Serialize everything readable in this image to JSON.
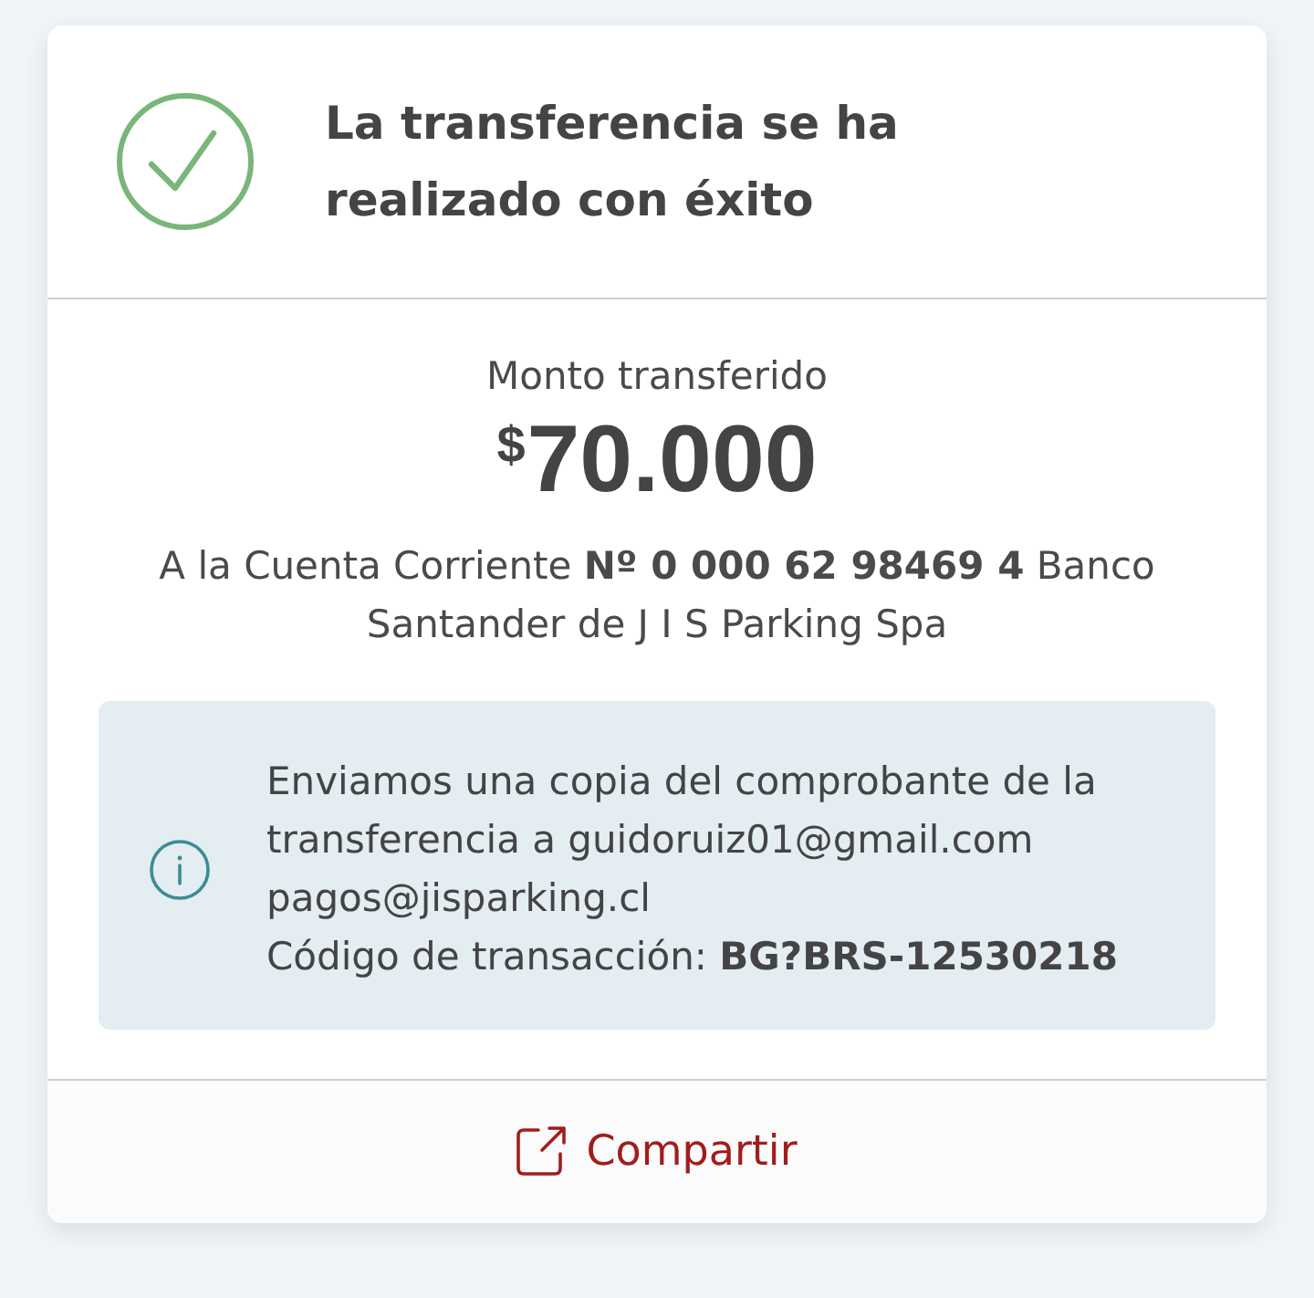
{
  "header": {
    "title": "La transferencia se ha realizado con éxito"
  },
  "amount": {
    "label": "Monto transferido",
    "currency": "$",
    "value": "70.000"
  },
  "destination": "A la Cuenta Corriente **Nº 0 000 62 98469 4** Banco Santander de J I S Parking Spa",
  "notice": {
    "paragraphs": [
      "Enviamos una copia del comprobante de la transferencia a guidoruiz01@gmail.com pagos@jisparking.cl",
      "Código de transacción: **BG?BRS-12530218**"
    ]
  },
  "actions": [
    {
      "kind": "share",
      "label": "Compartir"
    }
  ]
}
